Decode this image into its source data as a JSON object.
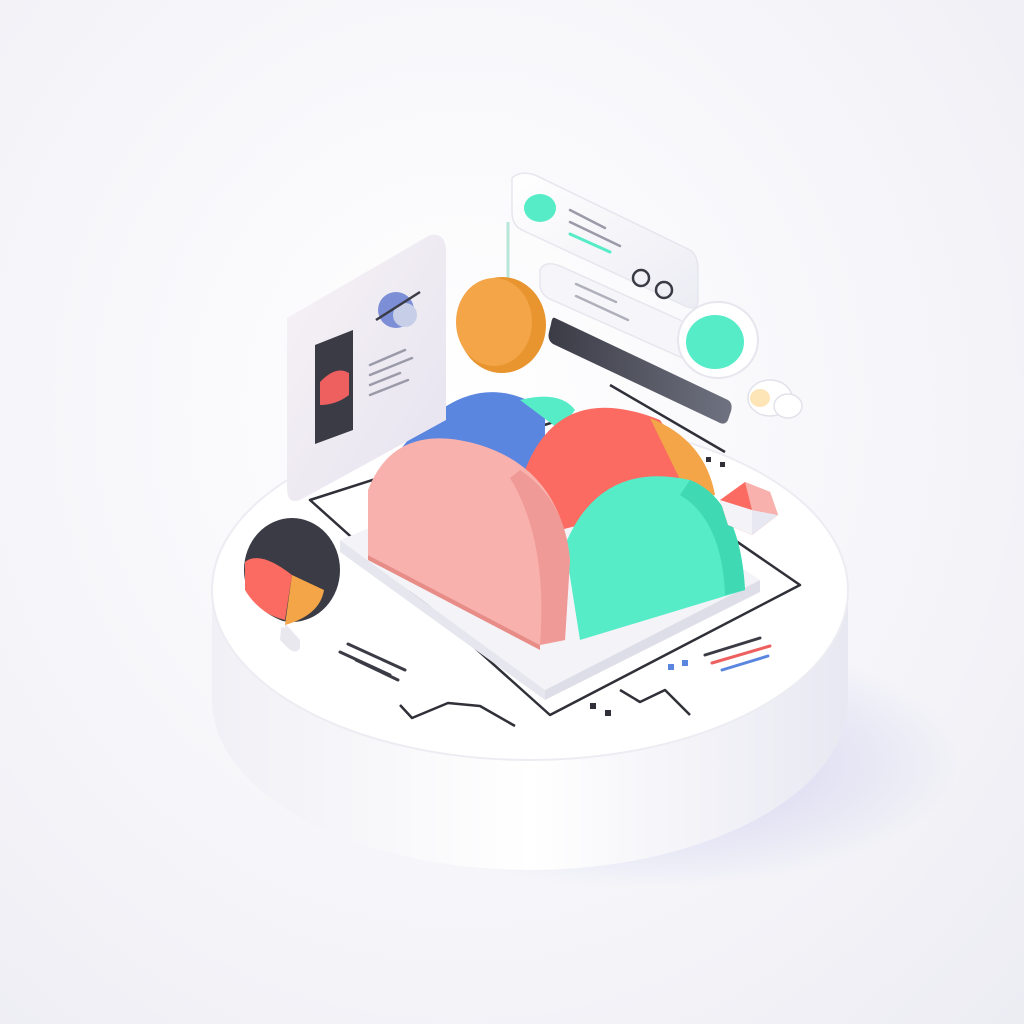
{
  "scene": {
    "kind": "isometric-3d-illustration",
    "text_visible": false
  },
  "colors": {
    "background": "#f3f3f7",
    "platform": "#ffffff",
    "pink": "#f9b1ad",
    "coral": "#fb6b62",
    "mint": "#56ecc7",
    "blue": "#5b86e0",
    "orange": "#f4a547",
    "dark": "#3a3b45",
    "line": "#2f3038",
    "red_accent": "#ee5f5f"
  },
  "icons": [
    "content-card-icon",
    "orange-coin-icon",
    "floating-panel-icon",
    "toggle-icon",
    "cloud-icon",
    "pie-marker-icon",
    "gem-icon",
    "arch-blocks-icon",
    "circuit-lines-icon"
  ]
}
